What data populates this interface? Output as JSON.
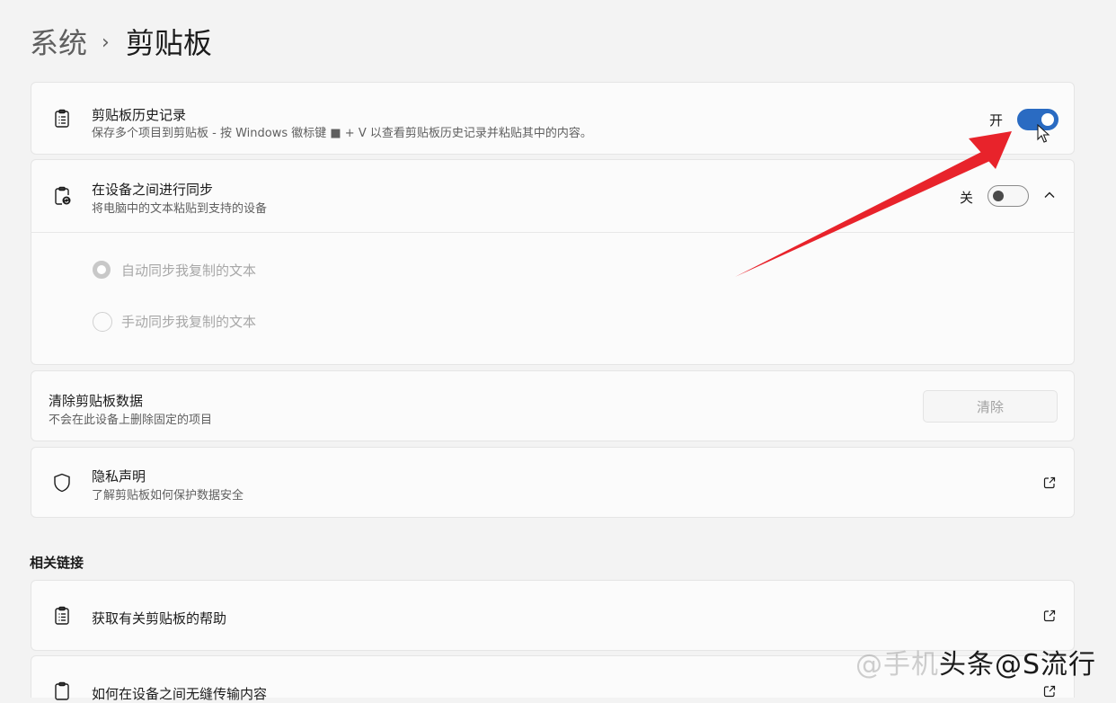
{
  "breadcrumb": {
    "parent": "系统",
    "separator": "›",
    "current": "剪贴板"
  },
  "clipboard_history": {
    "title": "剪贴板历史记录",
    "description": "保存多个项目到剪贴板 - 按 Windows 徽标键 ■ + V 以查看剪贴板历史记录并粘贴其中的内容。",
    "state_label": "开",
    "enabled": true,
    "icon": "clipboard-list-icon"
  },
  "sync": {
    "title": "在设备之间进行同步",
    "description": "将电脑中的文本粘贴到支持的设备",
    "state_label": "关",
    "enabled": false,
    "icon": "clipboard-sync-icon",
    "options": [
      {
        "label": "自动同步我复制的文本",
        "selected": true
      },
      {
        "label": "手动同步我复制的文本",
        "selected": false
      }
    ]
  },
  "clear_data": {
    "title": "清除剪贴板数据",
    "description": "不会在此设备上删除固定的项目",
    "button_label": "清除"
  },
  "privacy": {
    "title": "隐私声明",
    "description": "了解剪贴板如何保护数据安全",
    "icon": "shield-icon"
  },
  "related_links": {
    "heading": "相关链接",
    "items": [
      {
        "label": "获取有关剪贴板的帮助",
        "icon": "clipboard-list-icon"
      },
      {
        "label": "如何在设备之间无缝传输内容",
        "icon": "clipboard-icon"
      }
    ]
  },
  "watermark": {
    "faded": "@手机",
    "main": "头条@S流行"
  },
  "colors": {
    "accent": "#2a6bc2",
    "arrow": "#e8232b",
    "background": "#f3f3f3"
  }
}
